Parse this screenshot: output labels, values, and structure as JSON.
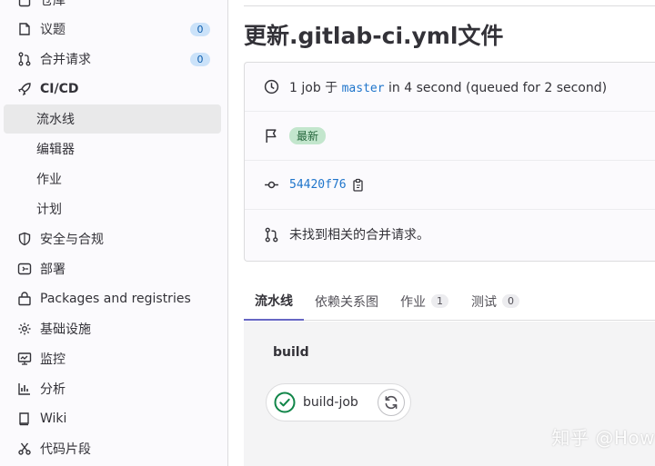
{
  "sidebar": {
    "items": [
      {
        "label": "仓库",
        "icon": "repository-icon"
      },
      {
        "label": "议题",
        "icon": "issues-icon",
        "count": "0"
      },
      {
        "label": "合并请求",
        "icon": "merge-request-icon",
        "count": "0"
      },
      {
        "label": "CI/CD",
        "icon": "rocket-icon"
      },
      {
        "label": "流水线"
      },
      {
        "label": "编辑器"
      },
      {
        "label": "作业"
      },
      {
        "label": "计划"
      },
      {
        "label": "安全与合规",
        "icon": "shield-icon"
      },
      {
        "label": "部署",
        "icon": "deploy-icon"
      },
      {
        "label": "Packages and registries",
        "icon": "package-icon"
      },
      {
        "label": "基础设施",
        "icon": "cloud-gear-icon"
      },
      {
        "label": "监控",
        "icon": "monitor-icon"
      },
      {
        "label": "分析",
        "icon": "chart-icon"
      },
      {
        "label": "Wiki",
        "icon": "book-icon"
      },
      {
        "label": "代码片段",
        "icon": "snippet-icon"
      }
    ]
  },
  "main": {
    "title": "更新.gitlab-ci.yml文件",
    "info": {
      "duration_prefix": "1 job 于",
      "branch": "master",
      "duration_suffix": "in 4 second (queued for 2 second)",
      "latest_badge": "最新",
      "commit_sha": "54420f76",
      "merge_request_text": "未找到相关的合并请求。"
    },
    "tabs": [
      {
        "label": "流水线"
      },
      {
        "label": "依赖关系图"
      },
      {
        "label": "作业",
        "count": "1"
      },
      {
        "label": "测试",
        "count": "0"
      }
    ],
    "pipeline": {
      "stage": "build",
      "job": "build-job",
      "job_status": "passed"
    }
  },
  "watermark": "知乎 @How",
  "colors": {
    "accent": "#6666c4",
    "link": "#1f75cb",
    "success": "#108548",
    "badge_bg": "#cbe2f9"
  }
}
